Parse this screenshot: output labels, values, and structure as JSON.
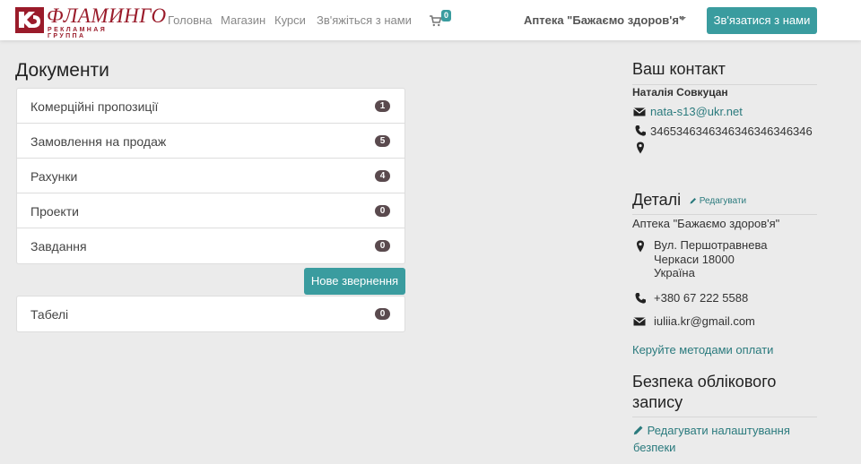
{
  "brand": {
    "name": "ФЛАМИНГО",
    "tagline": "РЕКЛАМНАЯ ГРУППА",
    "color": "#9a1b2a"
  },
  "nav": {
    "items": [
      "Головна",
      "Магазин",
      "Курси",
      "Зв'яжіться з нами"
    ],
    "cart_count": "0",
    "company": "Аптека \"Бажаємо здоров'я\"",
    "contact_button": "Зв'язатися з нами"
  },
  "documents": {
    "title": "Документи",
    "rows": [
      {
        "label": "Комерційні пропозиції",
        "count": "1"
      },
      {
        "label": "Замовлення на продаж",
        "count": "5"
      },
      {
        "label": "Рахунки",
        "count": "4"
      },
      {
        "label": "Проекти",
        "count": "0"
      },
      {
        "label": "Завдання",
        "count": "0"
      }
    ],
    "new_request_button": "Нове звернення",
    "timesheets": {
      "label": "Табелі",
      "count": "0"
    }
  },
  "contact": {
    "title": "Ваш контакт",
    "name": "Наталія Совкуцан",
    "email": "nata-s13@ukr.net",
    "phone": "3465346346346346346346346"
  },
  "details": {
    "title": "Деталі",
    "edit_link": "Редагувати",
    "company": "Аптека \"Бажаємо здоров'я\"",
    "address_line1": "Вул. Першотравнева",
    "address_line2": "Черкаси 18000",
    "address_line3": "Україна",
    "phone": "+380 67 222 5588",
    "email": "iuliia.kr@gmail.com",
    "payment_link": "Керуйте методами оплати"
  },
  "security": {
    "title_line1": "Безпека облікового",
    "title_line2": "запису",
    "edit_line1": "Редагувати налаштування",
    "edit_line2": "безпеки"
  },
  "colors": {
    "accent": "#3a9c9f",
    "badge": "#5a4a4e",
    "link": "#2a7a7d",
    "background": "#ebebeb"
  }
}
